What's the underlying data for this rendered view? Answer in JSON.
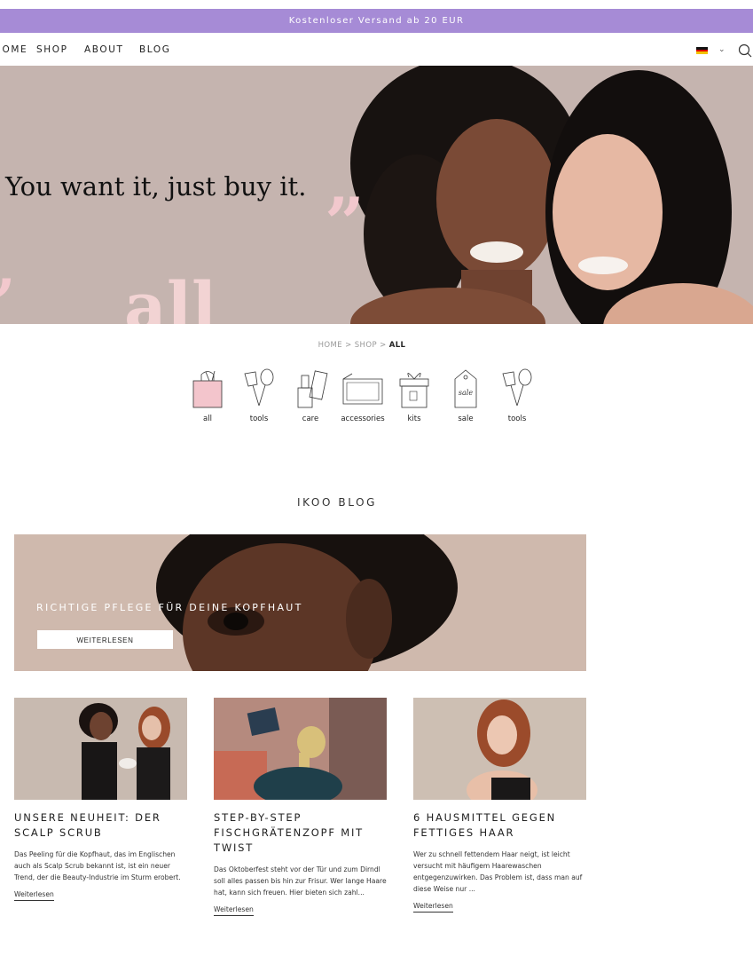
{
  "announcement": "Kostenloser Versand ab 20 EUR",
  "nav": {
    "items": [
      "HOME",
      "SHOP",
      "ABOUT",
      "BLOG"
    ]
  },
  "header_icons": {
    "language": "german-flag-icon",
    "dropdown": "chevron-down-icon",
    "search": "search-icon"
  },
  "hero": {
    "quote": "You want it, just buy it.",
    "word": "all",
    "colors": {
      "background": "#c5b4af",
      "accent": "#f2d3d3"
    }
  },
  "breadcrumb": {
    "home": "HOME",
    "sep": ">",
    "shop": "SHOP",
    "current": "ALL"
  },
  "categories": [
    {
      "label": "all",
      "icon": "shopping-bag-icon"
    },
    {
      "label": "tools",
      "icon": "brushes-icon"
    },
    {
      "label": "care",
      "icon": "bottles-icon"
    },
    {
      "label": "accessories",
      "icon": "pouch-icon"
    },
    {
      "label": "kits",
      "icon": "gift-box-icon"
    },
    {
      "label": "sale",
      "icon": "sale-tag-icon",
      "tag_text": "sale"
    },
    {
      "label": "tools",
      "icon": "brushes-icon"
    }
  ],
  "blog": {
    "title": "IKOO BLOG",
    "feature": {
      "title": "RICHTIGE PFLEGE FÜR DEINE KOPFHAUT",
      "button": "WEITERLESEN"
    },
    "posts": [
      {
        "title": "UNSERE NEUHEIT: DER SCALP SCRUB",
        "excerpt": "Das Peeling für die Kopfhaut, das im Englischen auch als Scalp Scrub bekannt ist, ist ein neuer Trend, der die Beauty-Industrie im Sturm erobert.",
        "link": "Weiterlesen"
      },
      {
        "title": "STEP-BY-STEP FISCHGRÄTENZOPF MIT TWIST",
        "excerpt": "Das Oktoberfest steht vor der Tür und zum Dirndl soll alles passen bis hin zur Frisur. Wer lange Haare hat, kann sich freuen. Hier bieten sich zahl...",
        "link": "Weiterlesen"
      },
      {
        "title": "6 HAUSMITTEL GEGEN FETTIGES HAAR",
        "excerpt": "Wer zu schnell fettendem Haar neigt, ist leicht versucht mit häufigem Haarewaschen entgegenzuwirken. Das Problem ist, dass man auf diese Weise nur ...",
        "link": "Weiterlesen"
      }
    ]
  }
}
